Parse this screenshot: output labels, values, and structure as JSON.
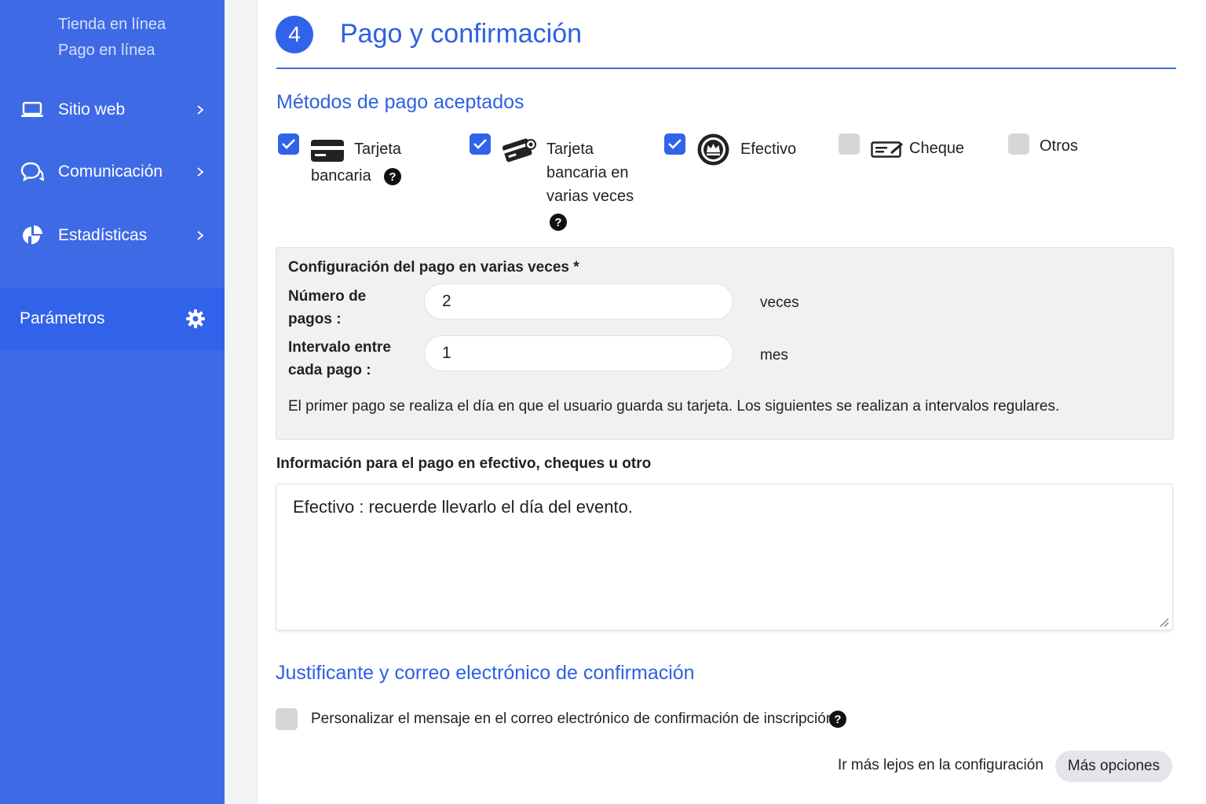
{
  "sidebar": {
    "sub_links": [
      "Tienda en línea",
      "Pago en línea"
    ],
    "items": [
      {
        "label": "Sitio web",
        "icon": "laptop-icon"
      },
      {
        "label": "Comunicación",
        "icon": "chat-icon"
      },
      {
        "label": "Estadísticas",
        "icon": "pie-chart-icon"
      }
    ],
    "active": {
      "label": "Parámetros",
      "icon": "gear-icon"
    }
  },
  "header": {
    "step": "4",
    "title": "Pago y confirmación"
  },
  "payment_methods": {
    "title": "Métodos de pago aceptados",
    "items": [
      {
        "label_lines": [
          "Tarjeta",
          "bancaria"
        ],
        "checked": true,
        "icon": "credit-card-icon",
        "help": true
      },
      {
        "label_lines": [
          "Tarjeta",
          "bancaria en",
          "varias veces"
        ],
        "checked": true,
        "icon": "multi-card-icon",
        "help": true
      },
      {
        "label_lines": [
          "Efectivo"
        ],
        "checked": true,
        "icon": "cash-icon",
        "help": false
      },
      {
        "label_lines": [
          "Cheque"
        ],
        "checked": false,
        "icon": "cheque-icon",
        "help": false
      },
      {
        "label_lines": [
          "Otros"
        ],
        "checked": false,
        "icon": "",
        "help": false
      }
    ]
  },
  "installments": {
    "title": "Configuración del pago en varias veces *",
    "payments_label_lines": [
      "Número de",
      "pagos :"
    ],
    "payments_value": "2",
    "payments_unit": "veces",
    "interval_label_lines": [
      "Intervalo entre",
      "cada pago :"
    ],
    "interval_value": "1",
    "interval_unit": "mes",
    "note": "El primer pago se realiza el día en que el usuario guarda su tarjeta. Los siguientes se realizan a intervalos regulares."
  },
  "info": {
    "title": "Información para el pago en efectivo, cheques u otro",
    "value": "Efectivo : recuerde llevarlo el día del evento."
  },
  "confirmation": {
    "title": "Justificante y correo electrónico de confirmación",
    "customize_label": "Personalizar el mensaje en el correo electrónico de confirmación de inscripción",
    "customize_checked": false
  },
  "footer": {
    "further_label": "Ir más lejos en la configuración",
    "more_button": "Más opciones"
  },
  "colors": {
    "sidebar_bg": "#3f6ae6",
    "accent": "#2f60e3",
    "checkbox_on": "#3163ea",
    "checkbox_off": "#d5d6d8"
  }
}
